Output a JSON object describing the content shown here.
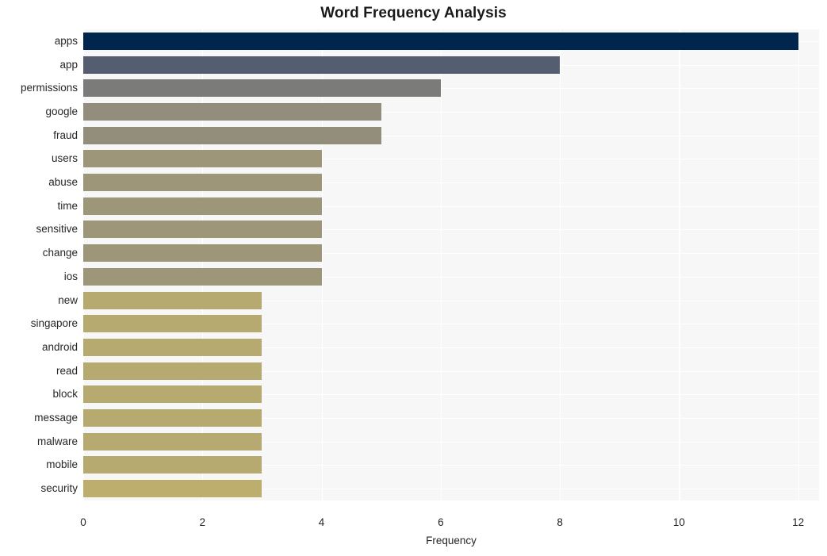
{
  "chart_data": {
    "type": "bar",
    "orientation": "horizontal",
    "title": "Word Frequency Analysis",
    "xlabel": "Frequency",
    "ylabel": "",
    "xlim": [
      0,
      12.35
    ],
    "xticks": [
      0,
      2,
      4,
      6,
      8,
      10,
      12
    ],
    "xtick_labels": [
      "0",
      "2",
      "4",
      "6",
      "8",
      "10",
      "12"
    ],
    "grid": true,
    "grid_axis": "both",
    "legend": false,
    "categories": [
      "apps",
      "app",
      "permissions",
      "google",
      "fraud",
      "users",
      "abuse",
      "time",
      "sensitive",
      "change",
      "ios",
      "new",
      "singapore",
      "android",
      "read",
      "block",
      "message",
      "malware",
      "mobile",
      "security"
    ],
    "values": [
      12,
      8,
      6,
      5,
      5,
      4,
      4,
      4,
      4,
      4,
      4,
      3,
      3,
      3,
      3,
      3,
      3,
      3,
      3,
      3
    ],
    "bar_colors": [
      "#00264d",
      "#555d70",
      "#7b7b79",
      "#928d7c",
      "#938e7c",
      "#9d9678",
      "#9d9678",
      "#9d9678",
      "#9d9678",
      "#9d9678",
      "#9d9678",
      "#b7aa70",
      "#b7aa70",
      "#b7aa70",
      "#b7aa70",
      "#b7aa70",
      "#b7aa70",
      "#b7aa70",
      "#b7aa70",
      "#bdae6d"
    ],
    "plot_background": "#f7f7f7",
    "grid_color": "#ffffff",
    "figure_background": "#ffffff"
  }
}
